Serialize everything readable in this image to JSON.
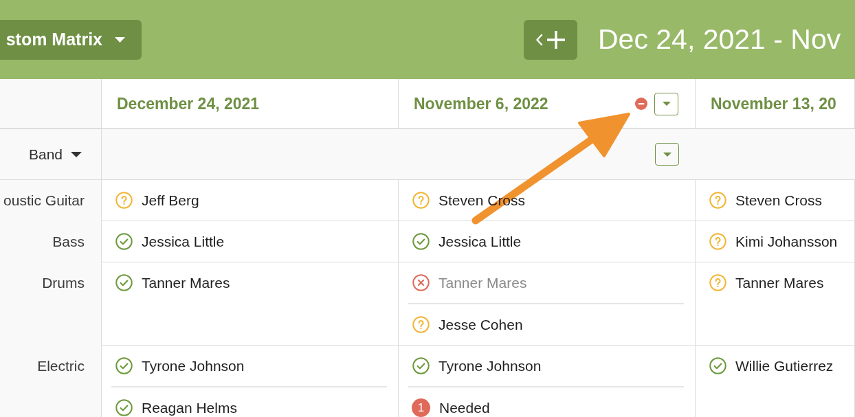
{
  "toolbar": {
    "view_menu": "stom Matrix",
    "date_range": "Dec 24, 2021 - Nov"
  },
  "matrix": {
    "group_label": "Band",
    "columns": [
      {
        "date": "December 24, 2021",
        "hovered": false
      },
      {
        "date": "November 6, 2022",
        "hovered": true
      },
      {
        "date": "November 13, 20",
        "hovered": false
      }
    ],
    "rows": [
      {
        "label": "oustic Guitar",
        "cells": [
          {
            "entries": [
              {
                "kind": "pending",
                "name": "Jeff Berg"
              }
            ]
          },
          {
            "entries": [
              {
                "kind": "pending",
                "name": "Steven Cross"
              }
            ]
          },
          {
            "entries": [
              {
                "kind": "pending",
                "name": "Steven Cross"
              }
            ]
          }
        ]
      },
      {
        "label": "Bass",
        "cells": [
          {
            "entries": [
              {
                "kind": "confirmed",
                "name": "Jessica Little"
              }
            ]
          },
          {
            "entries": [
              {
                "kind": "confirmed",
                "name": "Jessica Little"
              }
            ]
          },
          {
            "entries": [
              {
                "kind": "pending",
                "name": "Kimi Johansson"
              }
            ]
          }
        ]
      },
      {
        "label": "Drums",
        "cells": [
          {
            "entries": [
              {
                "kind": "confirmed",
                "name": "Tanner Mares"
              }
            ]
          },
          {
            "entries": [
              {
                "kind": "declined",
                "name": "Tanner Mares"
              },
              {
                "kind": "pending",
                "name": "Jesse Cohen"
              }
            ]
          },
          {
            "entries": [
              {
                "kind": "pending",
                "name": "Tanner Mares"
              }
            ]
          }
        ]
      },
      {
        "label": "Electric",
        "cells": [
          {
            "entries": [
              {
                "kind": "confirmed",
                "name": "Tyrone Johnson"
              },
              {
                "kind": "confirmed",
                "name": "Reagan Helms"
              }
            ]
          },
          {
            "entries": [
              {
                "kind": "confirmed",
                "name": "Tyrone Johnson"
              },
              {
                "kind": "needed",
                "count": "1",
                "name": "Needed"
              }
            ]
          },
          {
            "entries": [
              {
                "kind": "confirmed",
                "name": "Willie Gutierrez"
              }
            ]
          }
        ]
      }
    ]
  }
}
